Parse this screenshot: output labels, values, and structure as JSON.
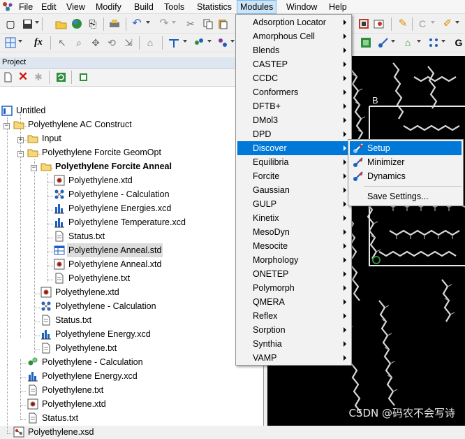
{
  "menubar": {
    "items": [
      "File",
      "Edit",
      "View",
      "Modify",
      "Build",
      "Tools",
      "Statistics",
      "Modules",
      "Window",
      "Help"
    ],
    "active": "Modules"
  },
  "toolbar2": {
    "fx_label": "fx"
  },
  "project": {
    "title": "Project",
    "tree": [
      {
        "label": "Untitled",
        "icon": "project-icon"
      },
      {
        "label": "Polyethylene AC Construct",
        "icon": "folder-icon"
      },
      {
        "label": "Input",
        "icon": "folder-icon"
      },
      {
        "label": "Polyethylene Forcite GeomOpt",
        "icon": "folder-icon"
      },
      {
        "label": "Polyethylene Forcite Anneal",
        "icon": "folder-icon"
      },
      {
        "label": "Polyethylene.xtd",
        "icon": "trajectory-icon"
      },
      {
        "label": "Polyethylene - Calculation",
        "icon": "calculation-icon"
      },
      {
        "label": "Polyethylene Energies.xcd",
        "icon": "chart-icon"
      },
      {
        "label": "Polyethylene Temperature.xcd",
        "icon": "chart-icon"
      },
      {
        "label": "Status.txt",
        "icon": "text-file-icon"
      },
      {
        "label": "Polyethylene Anneal.std",
        "icon": "study-table-icon"
      },
      {
        "label": "Polyethylene Anneal.xtd",
        "icon": "trajectory-icon"
      },
      {
        "label": "Polyethylene.txt",
        "icon": "text-file-icon"
      },
      {
        "label": "Polyethylene.xtd",
        "icon": "trajectory-icon"
      },
      {
        "label": "Polyethylene - Calculation",
        "icon": "calculation-icon"
      },
      {
        "label": "Status.txt",
        "icon": "text-file-icon"
      },
      {
        "label": "Polyethylene Energy.xcd",
        "icon": "chart-icon"
      },
      {
        "label": "Polyethylene.txt",
        "icon": "text-file-icon"
      },
      {
        "label": "Polyethylene - Calculation",
        "icon": "calculation-icon"
      },
      {
        "label": "Polyethylene Energy.xcd",
        "icon": "chart-icon"
      },
      {
        "label": "Polyethylene.txt",
        "icon": "text-file-icon"
      },
      {
        "label": "Polyethylene.xtd",
        "icon": "trajectory-icon"
      },
      {
        "label": "Status.txt",
        "icon": "text-file-icon"
      },
      {
        "label": "Polyethylene.xsd",
        "icon": "structure-icon"
      }
    ]
  },
  "modules_menu": {
    "items": [
      "Adsorption Locator",
      "Amorphous Cell",
      "Blends",
      "CASTEP",
      "CCDC",
      "Conformers",
      "DFTB+",
      "DMol3",
      "DPD",
      "Discover",
      "Equilibria",
      "Forcite",
      "Gaussian",
      "GULP",
      "Kinetix",
      "MesoDyn",
      "Mesocite",
      "Morphology",
      "ONETEP",
      "Polymorph",
      "QMERA",
      "Reflex",
      "Sorption",
      "Synthia",
      "VAMP"
    ],
    "highlighted": "Discover"
  },
  "discover_submenu": {
    "items": [
      "Setup",
      "Minimizer",
      "Dynamics"
    ],
    "save_settings": "Save Settings...",
    "highlighted": "Setup"
  },
  "viewer": {
    "axis_label_b": "B",
    "watermark": "CSDN @码农不会写诗"
  },
  "colors": {
    "highlight": "#0078d7",
    "menu_active": "#cce4f7",
    "viewer_bg": "#000000",
    "molecule": "#d8d8d8"
  }
}
